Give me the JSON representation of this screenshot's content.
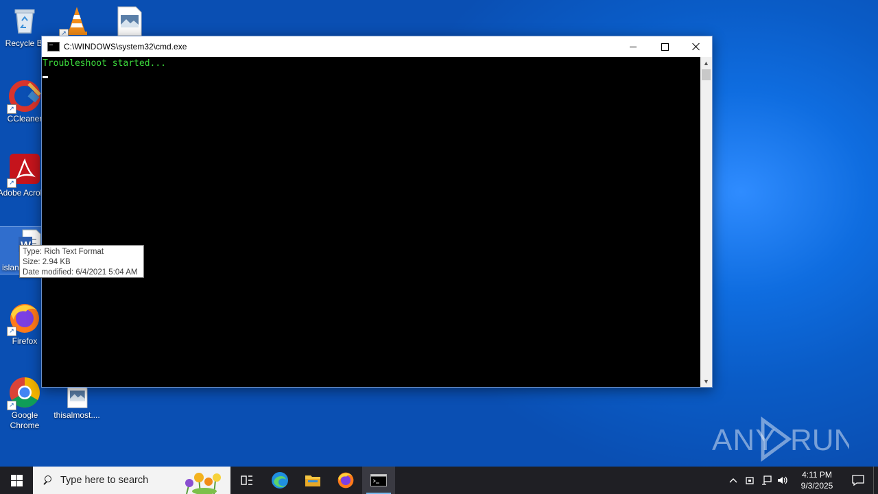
{
  "desktop": {
    "icons": [
      {
        "label": "Recycle Bin",
        "display": "Recycle Bi"
      },
      {
        "label": "VLC media player"
      },
      {
        "label": "image file"
      },
      {
        "label": "CCleaner",
        "display": "CCleaner"
      },
      {
        "label": "Adobe Acrobat",
        "display": "Adobe Acrobat"
      },
      {
        "label": "islan",
        "display": "islan"
      },
      {
        "label": "Firefox",
        "display": "Firefox"
      },
      {
        "label": "Google Chrome",
        "display": "Google Chrome"
      },
      {
        "label": "thisalmost....",
        "display": "thisalmost...."
      }
    ]
  },
  "cmd_window": {
    "title": "C:\\WINDOWS\\system32\\cmd.exe",
    "console_text": "Troubleshoot started...",
    "text_color": "#3ddc3d"
  },
  "tooltip": {
    "type": "Type: Rich Text Format",
    "size": "Size: 2.94 KB",
    "modified": "Date modified: 6/4/2021 5:04 AM"
  },
  "taskbar": {
    "search_placeholder": "Type here to search",
    "time": "4:11 PM",
    "date": "9/3/2025"
  },
  "watermark": {
    "text": "ANY RUN"
  }
}
